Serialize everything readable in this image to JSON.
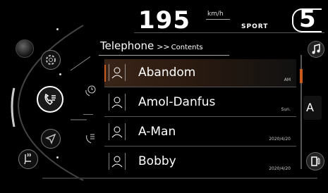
{
  "header": {
    "speed": "195",
    "speed_unit": "km/h",
    "drive_mode": "SPORT",
    "gear": "5"
  },
  "breadcrumb": {
    "title": "Telephone",
    "separator": ">>",
    "subtitle": "Contents"
  },
  "contacts": [
    {
      "name": "Abandom",
      "date": "AM",
      "selected": true
    },
    {
      "name": "Amol-Danfus",
      "date": "Sun."
    },
    {
      "name": "A-Man",
      "date": "2020/4/20"
    },
    {
      "name": "Bobby",
      "date": "2020/4/20"
    }
  ],
  "right_panel": {
    "index_letter": "A"
  },
  "colors": {
    "accent": "#c85a1e",
    "background": "#000000"
  },
  "icons": [
    "gear-icon",
    "phone-list-icon",
    "navigation-icon",
    "seat-heat-icon",
    "recent-calls-icon",
    "dialpad-icon",
    "music-note-icon",
    "fuel-pump-icon",
    "contact-person-icon"
  ]
}
